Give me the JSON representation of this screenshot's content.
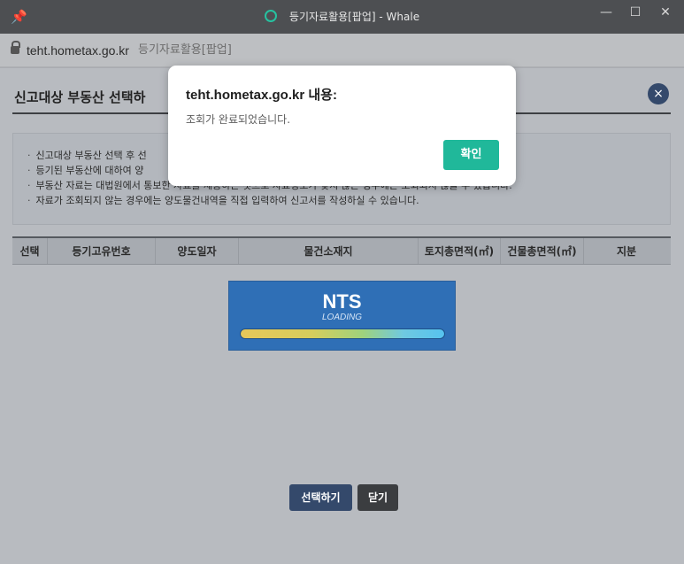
{
  "window": {
    "title": "등기자료활용[팝업] - Whale",
    "minimize_glyph": "—",
    "maximize_glyph": "☐",
    "close_glyph": "✕",
    "pin_icon": "pin-icon",
    "status_ring_color": "#26c2a0"
  },
  "address_bar": {
    "host": "teht.hometax.go.kr",
    "page_title": "등기자료활용[팝업]"
  },
  "page": {
    "title": "신고대상 부동산 선택하",
    "close_glyph": "×",
    "notices": [
      "신고대상 부동산 선택 후 선",
      "등기된 부동산에 대하여 양",
      "부동산 자료는 대법원에서 통보한 자료를 제공하는 것으로 자료정보가 맞지 않는 경우에는 조회되지 않을 수 있습니다.",
      "자료가 조회되지 않는 경우에는 양도물건내역을 직접 입력하여 신고서를 작성하실 수 있습니다."
    ],
    "table_headers": [
      "선택",
      "등기고유번호",
      "양도일자",
      "물건소재지",
      "토지총면적(㎡)",
      "건물총면적(㎡)",
      "지분"
    ],
    "loading": {
      "logo": "NTS",
      "text": "LOADING"
    },
    "buttons": {
      "select": "선택하기",
      "close": "닫기"
    }
  },
  "dialog": {
    "title": "teht.hometax.go.kr 내용:",
    "message": "조회가 완료되었습니다.",
    "ok_label": "확인",
    "ok_color": "#20b89a"
  }
}
